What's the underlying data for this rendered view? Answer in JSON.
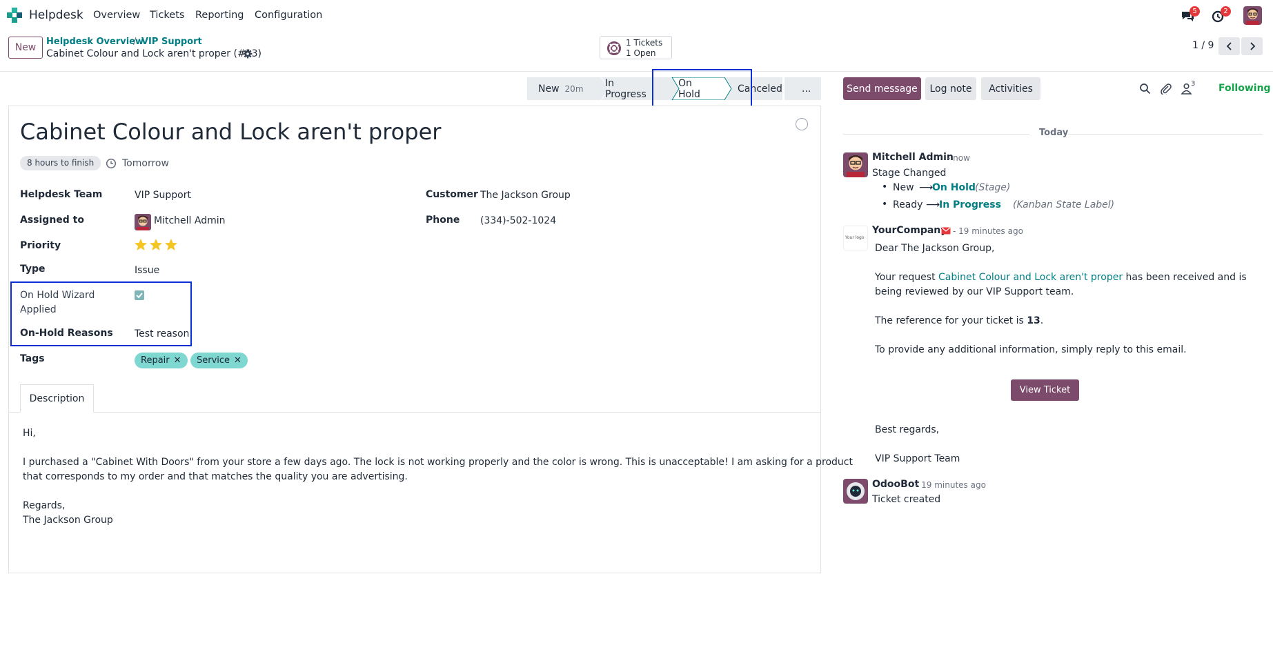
{
  "navbar": {
    "app_name": "Helpdesk",
    "menu": [
      "Overview",
      "Tickets",
      "Reporting",
      "Configuration"
    ],
    "messages_badge": "5",
    "activities_badge": "2"
  },
  "control_panel": {
    "new_label": "New",
    "breadcrumb": [
      "Helpdesk Overview",
      "VIP Support"
    ],
    "breadcrumb_sep": "/",
    "current": "Cabinet Colour and Lock aren't proper (#13)",
    "tickets_line1": "1 Tickets",
    "tickets_line2": "1 Open",
    "pager": "1 / 9"
  },
  "statusbar": {
    "stages": [
      {
        "label": "New",
        "duration": "20m"
      },
      {
        "label": "In Progress"
      },
      {
        "label": "On Hold"
      },
      {
        "label": "Canceled"
      },
      {
        "label": "..."
      }
    ]
  },
  "form": {
    "title": "Cabinet Colour and Lock aren't proper",
    "deadline_badge": "8 hours to finish",
    "deadline_date": "Tomorrow",
    "fields": {
      "team_label": "Helpdesk Team",
      "team_value": "VIP Support",
      "assigned_label": "Assigned to",
      "assigned_value": "Mitchell Admin",
      "priority_label": "Priority",
      "priority_stars": 3,
      "type_label": "Type",
      "type_value": "Issue",
      "onhold_wizard_label_1": "On Hold Wizard",
      "onhold_wizard_label_2": "Applied",
      "onhold_wizard_checked": true,
      "onhold_reasons_label": "On-Hold Reasons",
      "onhold_reasons_value": "Test reason",
      "tags_label": "Tags",
      "tags": [
        "Repair",
        "Service"
      ],
      "customer_label": "Customer",
      "customer_value": "The Jackson Group",
      "phone_label": "Phone",
      "phone_value": "(334)-502-1024"
    },
    "tab": "Description",
    "description": {
      "line1": "Hi,",
      "line2": "I purchased a \"Cabinet With Doors\" from your store a few days ago. The lock is not working properly and the color is wrong. This is unacceptable! I am asking for a product",
      "line3": "that corresponds to my order and that matches the quality you are advertising.",
      "line4": "Regards,",
      "line5": "The Jackson Group"
    }
  },
  "chatter": {
    "send_message": "Send message",
    "log_note": "Log note",
    "activities": "Activities",
    "followers_count": "3",
    "following": "Following",
    "today": "Today",
    "messages": [
      {
        "author": "Mitchell Admin",
        "time": "- now",
        "body": "Stage Changed",
        "change1_old": "New",
        "change1_new": "On Hold",
        "change1_field": "(Stage)",
        "change2_old": "Ready",
        "change2_new": "In Progress",
        "change2_field": "(Kanban State Label)"
      },
      {
        "author": "YourCompany",
        "time": "- 19 minutes ago",
        "logo_text": "Your logo",
        "greeting": "Dear The Jackson Group,",
        "p1_a": "Your request ",
        "p1_link": "Cabinet Colour and Lock aren't proper",
        "p1_b": " has been received and is",
        "p1_c": "being reviewed by our VIP Support team.",
        "p2_a": "The reference for your ticket is ",
        "p2_ref": "13",
        "p2_b": ".",
        "p3": "To provide any additional information, simply reply to this email.",
        "button": "View Ticket",
        "closing1": "Best regards,",
        "closing2": "VIP Support Team"
      },
      {
        "author": "OdooBot",
        "time": "- 19 minutes ago",
        "body": "Ticket created"
      }
    ]
  },
  "colors": {
    "brand": "#7c4a6a",
    "link": "#017e84",
    "highlight": "#0a2ed6",
    "tag": "#7ed7d1",
    "star": "#f3c623",
    "following": "#16a34a"
  }
}
